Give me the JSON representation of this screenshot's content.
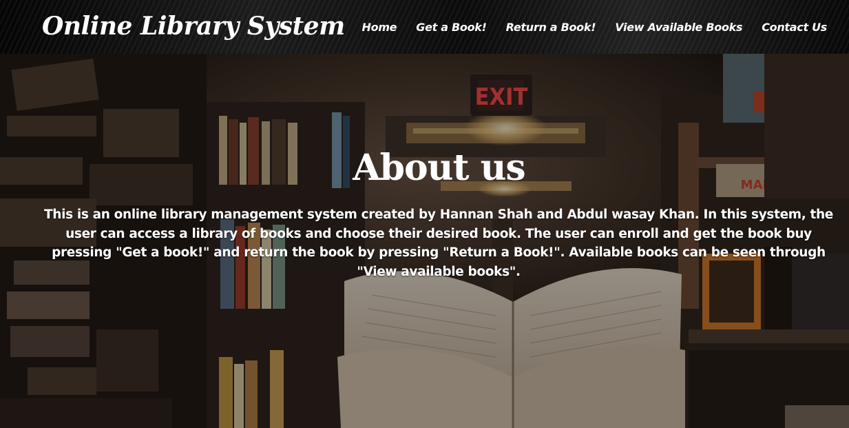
{
  "site": {
    "title": "Online Library System"
  },
  "nav": {
    "items": [
      {
        "label": "Home"
      },
      {
        "label": "Get a Book!"
      },
      {
        "label": "Return a Book!"
      },
      {
        "label": "View Available Books"
      },
      {
        "label": "Contact Us"
      }
    ]
  },
  "about": {
    "heading": "About us",
    "body": "This is an online library management system created by Hannan Shah and Abdul wasay Khan. In this system, the user can access a library of books and choose their desired book. The user can enroll and get the book buy pressing \"Get a book!\" and return the book by pressing \"Return a Book!\". Available books can be seen through \"View available books\"."
  },
  "background": {
    "exit_sign": "EXIT",
    "book_spine_text": "MARS TRILOG"
  },
  "colors": {
    "header": "#0e0e0e",
    "text": "#ffffff",
    "exit": "#ff3b3b"
  }
}
